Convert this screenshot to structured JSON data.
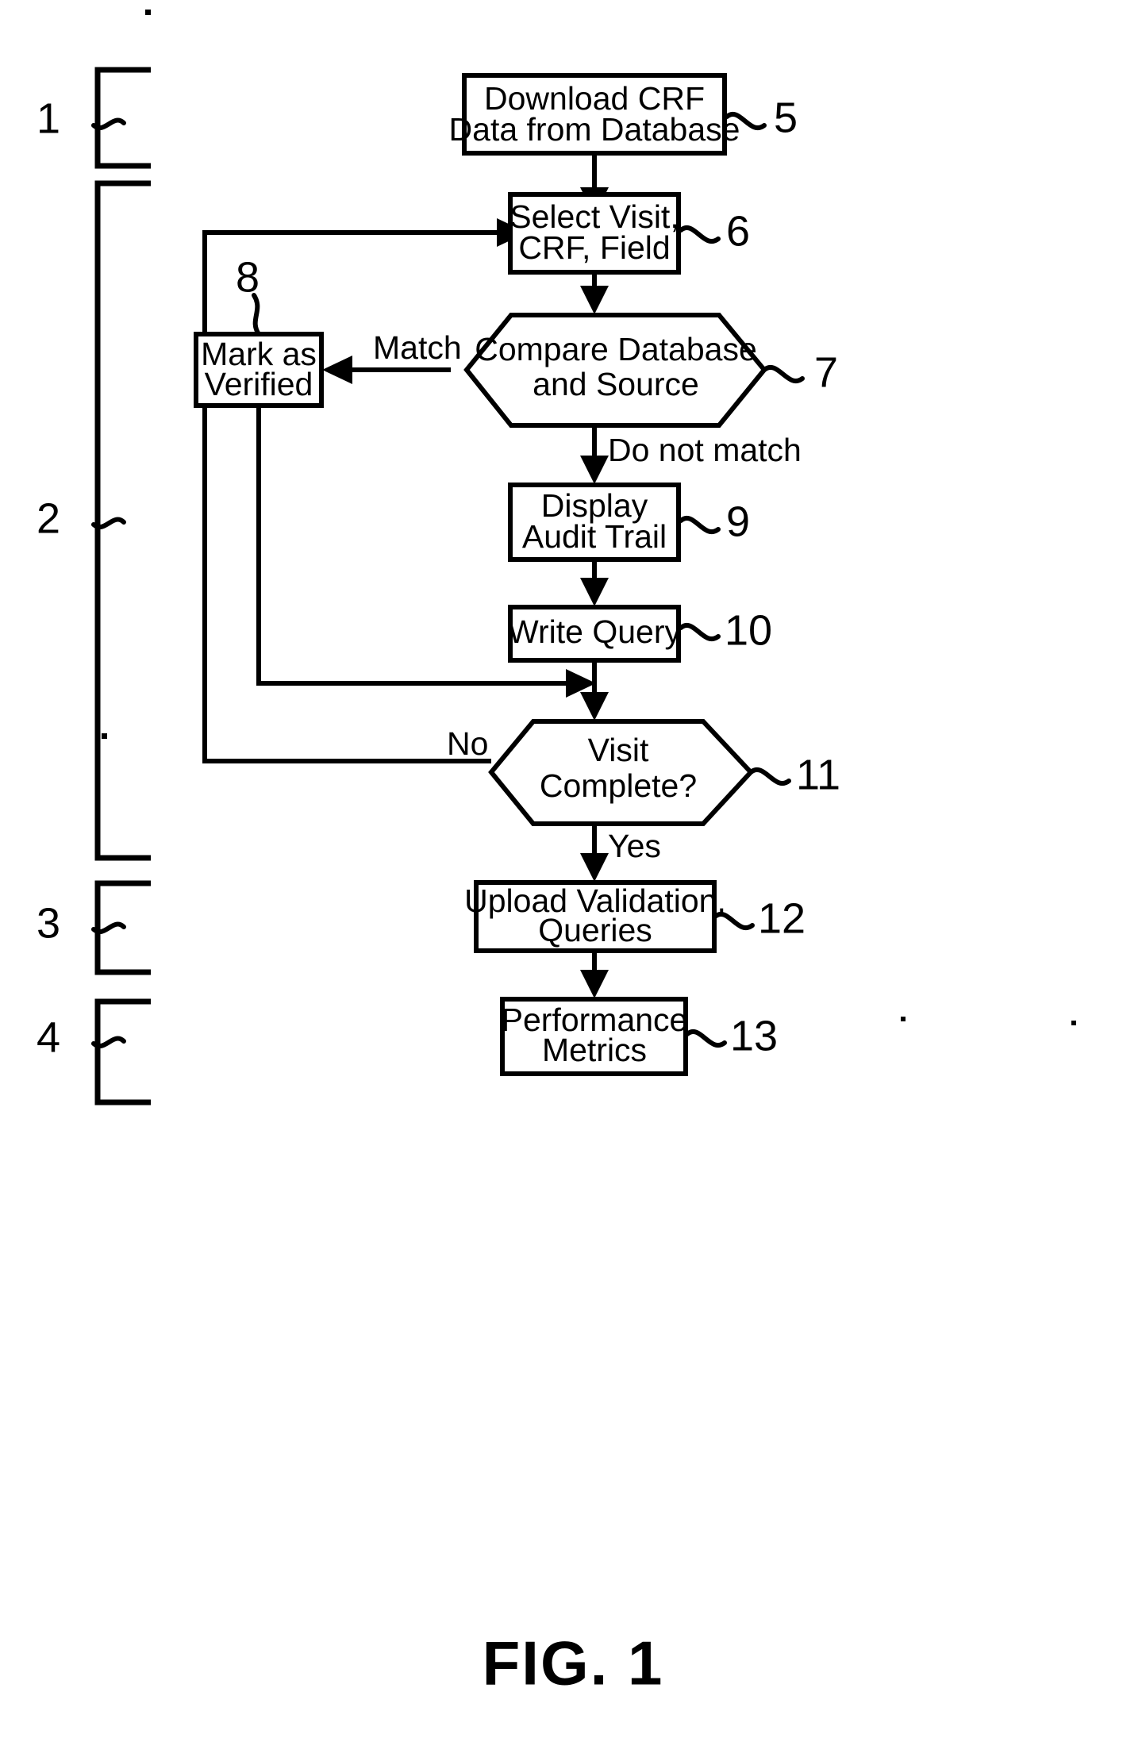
{
  "figure": {
    "caption": "FIG. 1",
    "title": "Source data verification process flowchart"
  },
  "nodes": [
    {
      "id": "download",
      "shape": "rectangle",
      "ref": "5",
      "lines": [
        "Download CRF",
        "Data from Database"
      ]
    },
    {
      "id": "select",
      "shape": "rectangle",
      "ref": "6",
      "lines": [
        "Select Visit,",
        "CRF, Field"
      ]
    },
    {
      "id": "compare",
      "shape": "hexagon",
      "ref": "7",
      "lines": [
        "Compare Database",
        "and Source"
      ]
    },
    {
      "id": "mark-verified",
      "shape": "rectangle",
      "ref": "8",
      "lines": [
        "Mark as",
        "Verified"
      ]
    },
    {
      "id": "audit-trail",
      "shape": "rectangle",
      "ref": "9",
      "lines": [
        "Display",
        "Audit Trail"
      ]
    },
    {
      "id": "write-query",
      "shape": "rectangle",
      "ref": "10",
      "lines": [
        "Write Query"
      ]
    },
    {
      "id": "visit-complete",
      "shape": "hexagon",
      "ref": "11",
      "lines": [
        "Visit",
        "Complete?"
      ]
    },
    {
      "id": "upload",
      "shape": "rectangle",
      "ref": "12",
      "lines": [
        "Upload Validation,",
        "Queries"
      ]
    },
    {
      "id": "performance",
      "shape": "rectangle",
      "ref": "13",
      "lines": [
        "Performance",
        "Metrics"
      ]
    }
  ],
  "edge_labels": {
    "match": "Match",
    "do_not_match": "Do not match",
    "no": "No",
    "yes": "Yes"
  },
  "brackets": [
    {
      "id": "phase-1",
      "ref": "1"
    },
    {
      "id": "phase-2",
      "ref": "2"
    },
    {
      "id": "phase-3",
      "ref": "3"
    },
    {
      "id": "phase-4",
      "ref": "4"
    }
  ],
  "ref_numbers": {
    "n1": "1",
    "n2": "2",
    "n3": "3",
    "n4": "4",
    "n5": "5",
    "n6": "6",
    "n7": "7",
    "n8": "8",
    "n9": "9",
    "n10": "10",
    "n11": "11",
    "n12": "12",
    "n13": "13"
  },
  "colors": {
    "ink": "#000000",
    "paper": "#ffffff"
  }
}
